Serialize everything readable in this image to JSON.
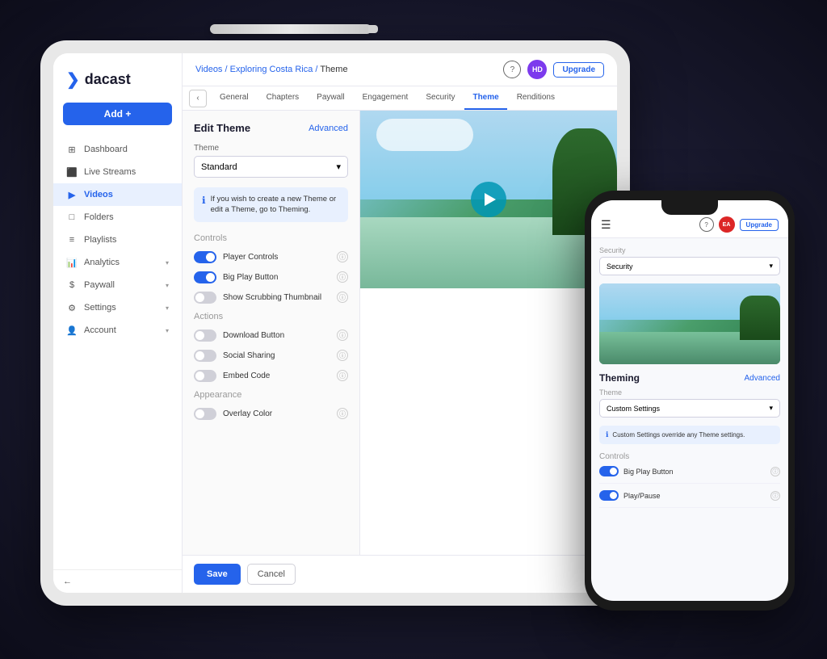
{
  "scene": {
    "background": "#1a1a2e"
  },
  "tablet": {
    "breadcrumb": {
      "videos": "Videos",
      "separator1": "/",
      "exploring": "Exploring Costa Rica",
      "separator2": "/",
      "theme": "Theme"
    },
    "topbar": {
      "help_label": "?",
      "user_initials": "HD",
      "upgrade_label": "Upgrade"
    },
    "tabs": [
      {
        "label": "General",
        "active": false
      },
      {
        "label": "Chapters",
        "active": false
      },
      {
        "label": "Paywall",
        "active": false
      },
      {
        "label": "Engagement",
        "active": false
      },
      {
        "label": "Security",
        "active": false
      },
      {
        "label": "Theme",
        "active": true
      },
      {
        "label": "Renditions",
        "active": false
      }
    ],
    "sidebar": {
      "logo_text": "dacast",
      "add_button": "Add +",
      "nav_items": [
        {
          "label": "Dashboard",
          "icon": "grid",
          "active": false
        },
        {
          "label": "Live Streams",
          "icon": "video",
          "active": false
        },
        {
          "label": "Videos",
          "icon": "play",
          "active": true
        },
        {
          "label": "Folders",
          "icon": "folder",
          "active": false
        },
        {
          "label": "Playlists",
          "icon": "list",
          "active": false
        },
        {
          "label": "Analytics",
          "icon": "chart",
          "active": false,
          "has_chevron": true
        },
        {
          "label": "Paywall",
          "icon": "dollar",
          "active": false,
          "has_chevron": true
        },
        {
          "label": "Settings",
          "icon": "gear",
          "active": false,
          "has_chevron": true
        },
        {
          "label": "Account",
          "icon": "person",
          "active": false,
          "has_chevron": true
        }
      ]
    },
    "edit_panel": {
      "title": "Edit Theme",
      "advanced_link": "Advanced",
      "theme_label": "Theme",
      "theme_value": "Standard",
      "info_text": "If you wish to create a new Theme or edit a Theme, go to Theming.",
      "controls_section": "Controls",
      "controls": [
        {
          "label": "Player Controls",
          "enabled": true
        },
        {
          "label": "Big Play Button",
          "enabled": true
        },
        {
          "label": "Show Scrubbing Thumbnail",
          "enabled": false
        }
      ],
      "actions_section": "Actions",
      "actions": [
        {
          "label": "Download Button",
          "enabled": false
        },
        {
          "label": "Social Sharing",
          "enabled": false
        },
        {
          "label": "Embed Code",
          "enabled": false
        }
      ],
      "appearance_section": "Appearance",
      "appearance_items": [
        {
          "label": "Overlay Color",
          "enabled": false
        }
      ]
    },
    "footer": {
      "save_label": "Save",
      "cancel_label": "Cancel"
    }
  },
  "phone": {
    "topbar": {
      "help_label": "?",
      "user_initials": "EA",
      "upgrade_label": "Upgrade"
    },
    "security_label": "Security",
    "theming": {
      "title": "Theming",
      "advanced_link": "Advanced",
      "theme_label": "Theme",
      "theme_value": "Custom Settings",
      "info_text": "Custom Settings override any Theme settings."
    },
    "controls_section": "Controls",
    "controls": [
      {
        "label": "Big Play Button",
        "enabled": true
      },
      {
        "label": "Play/Pause",
        "enabled": true
      }
    ]
  },
  "icons": {
    "play": "▶",
    "chevron_down": "▾",
    "chevron_left": "‹",
    "info": "ℹ",
    "help": "?",
    "grid": "▦",
    "video": "▶",
    "folder": "📁",
    "list": "≡",
    "chart": "📊",
    "dollar": "$",
    "gear": "⚙",
    "person": "👤",
    "menu": "☰",
    "back": "←"
  }
}
